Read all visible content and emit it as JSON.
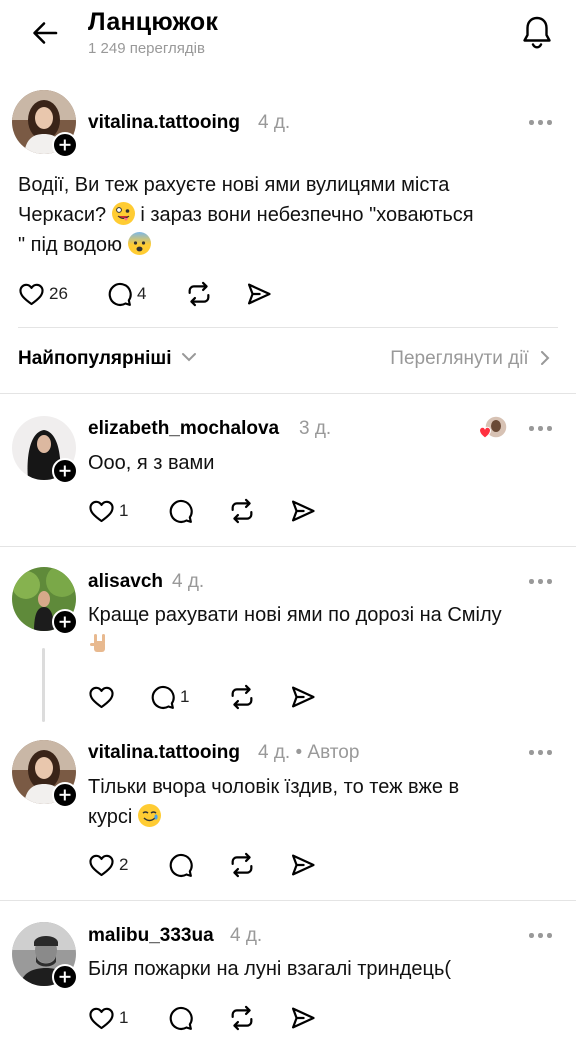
{
  "header": {
    "title": "Ланцюжок",
    "views": "1 249 переглядів"
  },
  "post": {
    "username": "vitalina.tattooing",
    "time": "4 д.",
    "line1": "Водії, Ви теж рахуєте нові ями вулицями міста",
    "line2a": "Черкаси?",
    "line2b": "і зараз вони небезпечно \"ховаються",
    "line3": "\" під водою",
    "likes": "26",
    "comments": "4"
  },
  "sort": {
    "label": "Найпопулярніші",
    "activity": "Переглянути дії"
  },
  "replies": [
    {
      "username": "elizabeth_mochalova",
      "time": "3 д.",
      "text": "Ооо, я з вами",
      "likes": "1",
      "comments": ""
    },
    {
      "username": "alisavch",
      "time": "4 д.",
      "text": "Краще рахувати нові ями по дорозі на Смілу",
      "likes": "",
      "comments": "1"
    },
    {
      "username": "vitalina.tattooing",
      "time": "4 д.",
      "author_tag": "• Автор",
      "line1": "Тільки вчора чоловік їздив, то теж вже в",
      "line2": "курсі",
      "likes": "2",
      "comments": ""
    },
    {
      "username": "malibu_333ua",
      "time": "4 д.",
      "text": "Біля пожарки на луні взагалі триндець(",
      "likes": "1",
      "comments": ""
    }
  ],
  "icons": {
    "back": "arrow-left-icon",
    "bell": "bell-icon",
    "like": "heart-icon",
    "comment": "comment-bubble-icon",
    "repost": "repost-icon",
    "share": "send-icon"
  }
}
